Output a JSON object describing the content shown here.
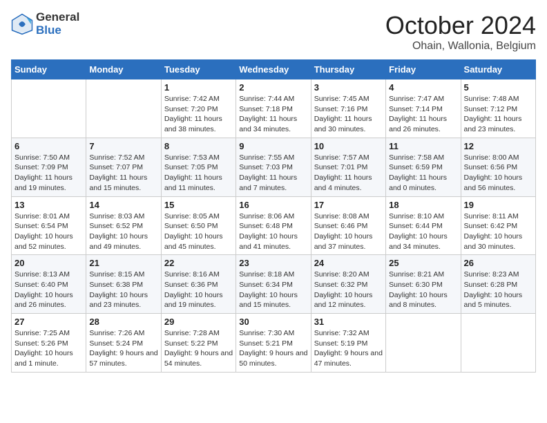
{
  "header": {
    "logo_line1": "General",
    "logo_line2": "Blue",
    "month": "October 2024",
    "location": "Ohain, Wallonia, Belgium"
  },
  "weekdays": [
    "Sunday",
    "Monday",
    "Tuesday",
    "Wednesday",
    "Thursday",
    "Friday",
    "Saturday"
  ],
  "weeks": [
    [
      {
        "day": "",
        "sunrise": "",
        "sunset": "",
        "daylight": ""
      },
      {
        "day": "",
        "sunrise": "",
        "sunset": "",
        "daylight": ""
      },
      {
        "day": "1",
        "sunrise": "Sunrise: 7:42 AM",
        "sunset": "Sunset: 7:20 PM",
        "daylight": "Daylight: 11 hours and 38 minutes."
      },
      {
        "day": "2",
        "sunrise": "Sunrise: 7:44 AM",
        "sunset": "Sunset: 7:18 PM",
        "daylight": "Daylight: 11 hours and 34 minutes."
      },
      {
        "day": "3",
        "sunrise": "Sunrise: 7:45 AM",
        "sunset": "Sunset: 7:16 PM",
        "daylight": "Daylight: 11 hours and 30 minutes."
      },
      {
        "day": "4",
        "sunrise": "Sunrise: 7:47 AM",
        "sunset": "Sunset: 7:14 PM",
        "daylight": "Daylight: 11 hours and 26 minutes."
      },
      {
        "day": "5",
        "sunrise": "Sunrise: 7:48 AM",
        "sunset": "Sunset: 7:12 PM",
        "daylight": "Daylight: 11 hours and 23 minutes."
      }
    ],
    [
      {
        "day": "6",
        "sunrise": "Sunrise: 7:50 AM",
        "sunset": "Sunset: 7:09 PM",
        "daylight": "Daylight: 11 hours and 19 minutes."
      },
      {
        "day": "7",
        "sunrise": "Sunrise: 7:52 AM",
        "sunset": "Sunset: 7:07 PM",
        "daylight": "Daylight: 11 hours and 15 minutes."
      },
      {
        "day": "8",
        "sunrise": "Sunrise: 7:53 AM",
        "sunset": "Sunset: 7:05 PM",
        "daylight": "Daylight: 11 hours and 11 minutes."
      },
      {
        "day": "9",
        "sunrise": "Sunrise: 7:55 AM",
        "sunset": "Sunset: 7:03 PM",
        "daylight": "Daylight: 11 hours and 7 minutes."
      },
      {
        "day": "10",
        "sunrise": "Sunrise: 7:57 AM",
        "sunset": "Sunset: 7:01 PM",
        "daylight": "Daylight: 11 hours and 4 minutes."
      },
      {
        "day": "11",
        "sunrise": "Sunrise: 7:58 AM",
        "sunset": "Sunset: 6:59 PM",
        "daylight": "Daylight: 11 hours and 0 minutes."
      },
      {
        "day": "12",
        "sunrise": "Sunrise: 8:00 AM",
        "sunset": "Sunset: 6:56 PM",
        "daylight": "Daylight: 10 hours and 56 minutes."
      }
    ],
    [
      {
        "day": "13",
        "sunrise": "Sunrise: 8:01 AM",
        "sunset": "Sunset: 6:54 PM",
        "daylight": "Daylight: 10 hours and 52 minutes."
      },
      {
        "day": "14",
        "sunrise": "Sunrise: 8:03 AM",
        "sunset": "Sunset: 6:52 PM",
        "daylight": "Daylight: 10 hours and 49 minutes."
      },
      {
        "day": "15",
        "sunrise": "Sunrise: 8:05 AM",
        "sunset": "Sunset: 6:50 PM",
        "daylight": "Daylight: 10 hours and 45 minutes."
      },
      {
        "day": "16",
        "sunrise": "Sunrise: 8:06 AM",
        "sunset": "Sunset: 6:48 PM",
        "daylight": "Daylight: 10 hours and 41 minutes."
      },
      {
        "day": "17",
        "sunrise": "Sunrise: 8:08 AM",
        "sunset": "Sunset: 6:46 PM",
        "daylight": "Daylight: 10 hours and 37 minutes."
      },
      {
        "day": "18",
        "sunrise": "Sunrise: 8:10 AM",
        "sunset": "Sunset: 6:44 PM",
        "daylight": "Daylight: 10 hours and 34 minutes."
      },
      {
        "day": "19",
        "sunrise": "Sunrise: 8:11 AM",
        "sunset": "Sunset: 6:42 PM",
        "daylight": "Daylight: 10 hours and 30 minutes."
      }
    ],
    [
      {
        "day": "20",
        "sunrise": "Sunrise: 8:13 AM",
        "sunset": "Sunset: 6:40 PM",
        "daylight": "Daylight: 10 hours and 26 minutes."
      },
      {
        "day": "21",
        "sunrise": "Sunrise: 8:15 AM",
        "sunset": "Sunset: 6:38 PM",
        "daylight": "Daylight: 10 hours and 23 minutes."
      },
      {
        "day": "22",
        "sunrise": "Sunrise: 8:16 AM",
        "sunset": "Sunset: 6:36 PM",
        "daylight": "Daylight: 10 hours and 19 minutes."
      },
      {
        "day": "23",
        "sunrise": "Sunrise: 8:18 AM",
        "sunset": "Sunset: 6:34 PM",
        "daylight": "Daylight: 10 hours and 15 minutes."
      },
      {
        "day": "24",
        "sunrise": "Sunrise: 8:20 AM",
        "sunset": "Sunset: 6:32 PM",
        "daylight": "Daylight: 10 hours and 12 minutes."
      },
      {
        "day": "25",
        "sunrise": "Sunrise: 8:21 AM",
        "sunset": "Sunset: 6:30 PM",
        "daylight": "Daylight: 10 hours and 8 minutes."
      },
      {
        "day": "26",
        "sunrise": "Sunrise: 8:23 AM",
        "sunset": "Sunset: 6:28 PM",
        "daylight": "Daylight: 10 hours and 5 minutes."
      }
    ],
    [
      {
        "day": "27",
        "sunrise": "Sunrise: 7:25 AM",
        "sunset": "Sunset: 5:26 PM",
        "daylight": "Daylight: 10 hours and 1 minute."
      },
      {
        "day": "28",
        "sunrise": "Sunrise: 7:26 AM",
        "sunset": "Sunset: 5:24 PM",
        "daylight": "Daylight: 9 hours and 57 minutes."
      },
      {
        "day": "29",
        "sunrise": "Sunrise: 7:28 AM",
        "sunset": "Sunset: 5:22 PM",
        "daylight": "Daylight: 9 hours and 54 minutes."
      },
      {
        "day": "30",
        "sunrise": "Sunrise: 7:30 AM",
        "sunset": "Sunset: 5:21 PM",
        "daylight": "Daylight: 9 hours and 50 minutes."
      },
      {
        "day": "31",
        "sunrise": "Sunrise: 7:32 AM",
        "sunset": "Sunset: 5:19 PM",
        "daylight": "Daylight: 9 hours and 47 minutes."
      },
      {
        "day": "",
        "sunrise": "",
        "sunset": "",
        "daylight": ""
      },
      {
        "day": "",
        "sunrise": "",
        "sunset": "",
        "daylight": ""
      }
    ]
  ]
}
